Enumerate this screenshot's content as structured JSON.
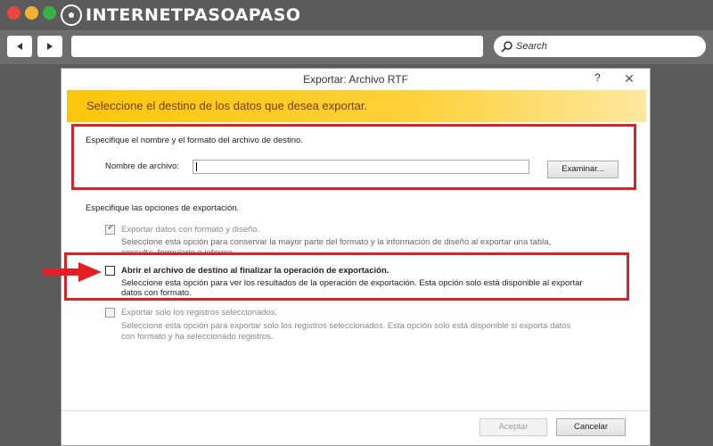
{
  "browser": {
    "logo_text_a": "INTERNET",
    "logo_text_b": "PASOAPASO",
    "search_label": "Search"
  },
  "dialog": {
    "title": "Exportar: Archivo RTF",
    "help": "?",
    "close": "✕",
    "banner": "Seleccione el destino de los datos que desea exportar.",
    "section1": "Especifique el nombre y el formato del archivo de destino.",
    "filename_label": "Nombre de archivo:",
    "filename_value": "",
    "browse_button": "Examinar...",
    "section2": "Especifique las opciones de exportación.",
    "options": [
      {
        "label": "Exportar datos con formato y diseño.",
        "desc_line1": "Seleccione esta opción para conservar la mayor parte del formato y la información de diseño al exportar una tabla,",
        "desc_line2": "consulta, formulario o informe.",
        "checked": true,
        "enabled": false
      },
      {
        "label": "Abrir el archivo de destino al finalizar la operación de exportación.",
        "desc_line1": "Seleccione esta opción para ver los resultados de la operación de exportación. Esta opción solo está disponible al exportar",
        "desc_line2": "datos con formato.",
        "checked": false,
        "enabled": true
      },
      {
        "label": "Exportar solo los registros seleccionados.",
        "desc_line1": "Seleccione esta opción para exportar solo los registros seleccionados. Esta opción solo está disponible si exporta datos",
        "desc_line2": "con formato y ha seleccionado registros.",
        "checked": false,
        "enabled": false
      }
    ],
    "accept_button": "Aceptar",
    "cancel_button": "Cancelar"
  },
  "colors": {
    "highlight_red": "#d8232a",
    "banner_yellow": "#fcc60a"
  }
}
